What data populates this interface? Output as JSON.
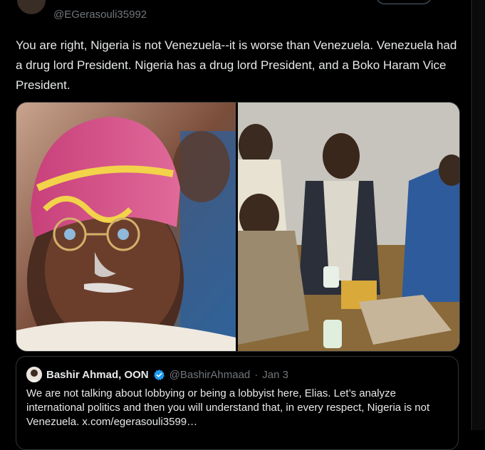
{
  "author": {
    "handle": "@EGerasouli35992"
  },
  "post": {
    "text": "You are right, Nigeria is not Venezuela--it is worse than Venezuela. Venezuela had a drug lord President. Nigeria has a drug lord President, and a Boko Haram Vice President."
  },
  "media": {
    "left_icon": "portrait-photo",
    "right_icon": "group-photo"
  },
  "quote": {
    "name": "Bashir Ahmad, OON",
    "handle": "@BashirAhmaad",
    "separator": "·",
    "date": "Jan 3",
    "text": "We are not talking about lobbying or being a lobbyist here, Elias. Let’s analyze international politics and then you will understand that, in every respect, Nigeria is not Venezuela. x.com/egerasouli3599…",
    "verified_color": "#1d9bf0"
  },
  "colors": {
    "background": "#000000",
    "text": "#e7e9ea",
    "muted": "#71767b",
    "border": "#2f3336"
  }
}
